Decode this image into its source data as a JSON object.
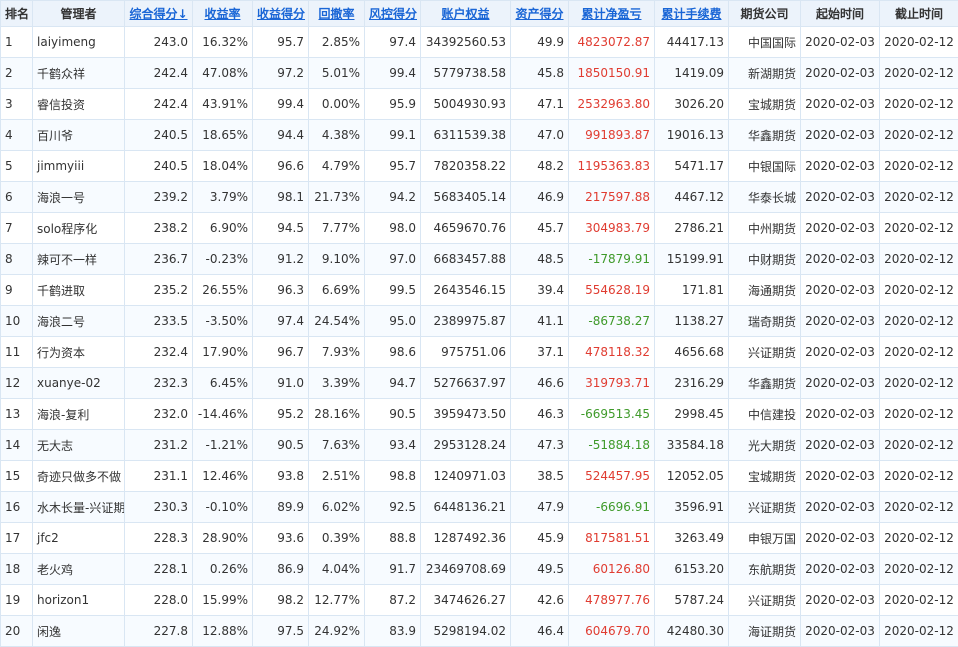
{
  "colors": {
    "header_bg": "#ecf3fb",
    "link": "#1a66d6",
    "positive": "#e03c31",
    "negative": "#3f9a2a",
    "border": "#d9e6f3"
  },
  "headers": [
    {
      "label": "排名",
      "sortable": false
    },
    {
      "label": "管理者",
      "sortable": false
    },
    {
      "label": "综合得分↓",
      "sortable": true
    },
    {
      "label": "收益率",
      "sortable": true
    },
    {
      "label": "收益得分",
      "sortable": true
    },
    {
      "label": "回撤率",
      "sortable": true
    },
    {
      "label": "风控得分",
      "sortable": true
    },
    {
      "label": "账户权益",
      "sortable": true
    },
    {
      "label": "资产得分",
      "sortable": true
    },
    {
      "label": "累计净盈亏",
      "sortable": true
    },
    {
      "label": "累计手续费",
      "sortable": true
    },
    {
      "label": "期货公司",
      "sortable": false
    },
    {
      "label": "起始时间",
      "sortable": false
    },
    {
      "label": "截止时间",
      "sortable": false
    }
  ],
  "rows": [
    {
      "rank": "1",
      "manager": "laiyimeng",
      "score": "243.0",
      "ret": "16.32%",
      "ret_score": "95.7",
      "dd": "2.85%",
      "risk_score": "97.4",
      "equity": "34392560.53",
      "asset_score": "49.9",
      "pnl": "4823072.87",
      "pnl_sign": "pos",
      "fee": "44417.13",
      "broker": "中国国际",
      "start": "2020-02-03",
      "end": "2020-02-12"
    },
    {
      "rank": "2",
      "manager": "千鹤众祥",
      "score": "242.4",
      "ret": "47.08%",
      "ret_score": "97.2",
      "dd": "5.01%",
      "risk_score": "99.4",
      "equity": "5779738.58",
      "asset_score": "45.8",
      "pnl": "1850150.91",
      "pnl_sign": "pos",
      "fee": "1419.09",
      "broker": "新湖期货",
      "start": "2020-02-03",
      "end": "2020-02-12"
    },
    {
      "rank": "3",
      "manager": "睿信投资",
      "score": "242.4",
      "ret": "43.91%",
      "ret_score": "99.4",
      "dd": "0.00%",
      "risk_score": "95.9",
      "equity": "5004930.93",
      "asset_score": "47.1",
      "pnl": "2532963.80",
      "pnl_sign": "pos",
      "fee": "3026.20",
      "broker": "宝城期货",
      "start": "2020-02-03",
      "end": "2020-02-12"
    },
    {
      "rank": "4",
      "manager": "百川爷",
      "score": "240.5",
      "ret": "18.65%",
      "ret_score": "94.4",
      "dd": "4.38%",
      "risk_score": "99.1",
      "equity": "6311539.38",
      "asset_score": "47.0",
      "pnl": "991893.87",
      "pnl_sign": "pos",
      "fee": "19016.13",
      "broker": "华鑫期货",
      "start": "2020-02-03",
      "end": "2020-02-12"
    },
    {
      "rank": "5",
      "manager": "jimmyiii",
      "score": "240.5",
      "ret": "18.04%",
      "ret_score": "96.6",
      "dd": "4.79%",
      "risk_score": "95.7",
      "equity": "7820358.22",
      "asset_score": "48.2",
      "pnl": "1195363.83",
      "pnl_sign": "pos",
      "fee": "5471.17",
      "broker": "中银国际",
      "start": "2020-02-03",
      "end": "2020-02-12"
    },
    {
      "rank": "6",
      "manager": "海浪一号",
      "score": "239.2",
      "ret": "3.79%",
      "ret_score": "98.1",
      "dd": "21.73%",
      "risk_score": "94.2",
      "equity": "5683405.14",
      "asset_score": "46.9",
      "pnl": "217597.88",
      "pnl_sign": "pos",
      "fee": "4467.12",
      "broker": "华泰长城",
      "start": "2020-02-03",
      "end": "2020-02-12"
    },
    {
      "rank": "7",
      "manager": "solo程序化",
      "score": "238.2",
      "ret": "6.90%",
      "ret_score": "94.5",
      "dd": "7.77%",
      "risk_score": "98.0",
      "equity": "4659670.76",
      "asset_score": "45.7",
      "pnl": "304983.79",
      "pnl_sign": "pos",
      "fee": "2786.21",
      "broker": "中州期货",
      "start": "2020-02-03",
      "end": "2020-02-12"
    },
    {
      "rank": "8",
      "manager": "辣可不一样",
      "score": "236.7",
      "ret": "-0.23%",
      "ret_score": "91.2",
      "dd": "9.10%",
      "risk_score": "97.0",
      "equity": "6683457.88",
      "asset_score": "48.5",
      "pnl": "-17879.91",
      "pnl_sign": "neg",
      "fee": "15199.91",
      "broker": "中财期货",
      "start": "2020-02-03",
      "end": "2020-02-12"
    },
    {
      "rank": "9",
      "manager": "千鹤进取",
      "score": "235.2",
      "ret": "26.55%",
      "ret_score": "96.3",
      "dd": "6.69%",
      "risk_score": "99.5",
      "equity": "2643546.15",
      "asset_score": "39.4",
      "pnl": "554628.19",
      "pnl_sign": "pos",
      "fee": "171.81",
      "broker": "海通期货",
      "start": "2020-02-03",
      "end": "2020-02-12"
    },
    {
      "rank": "10",
      "manager": "海浪二号",
      "score": "233.5",
      "ret": "-3.50%",
      "ret_score": "97.4",
      "dd": "24.54%",
      "risk_score": "95.0",
      "equity": "2389975.87",
      "asset_score": "41.1",
      "pnl": "-86738.27",
      "pnl_sign": "neg",
      "fee": "1138.27",
      "broker": "瑞奇期货",
      "start": "2020-02-03",
      "end": "2020-02-12"
    },
    {
      "rank": "11",
      "manager": "行为资本",
      "score": "232.4",
      "ret": "17.90%",
      "ret_score": "96.7",
      "dd": "7.93%",
      "risk_score": "98.6",
      "equity": "975751.06",
      "asset_score": "37.1",
      "pnl": "478118.32",
      "pnl_sign": "pos",
      "fee": "4656.68",
      "broker": "兴证期货",
      "start": "2020-02-03",
      "end": "2020-02-12"
    },
    {
      "rank": "12",
      "manager": "xuanye-02",
      "score": "232.3",
      "ret": "6.45%",
      "ret_score": "91.0",
      "dd": "3.39%",
      "risk_score": "94.7",
      "equity": "5276637.97",
      "asset_score": "46.6",
      "pnl": "319793.71",
      "pnl_sign": "pos",
      "fee": "2316.29",
      "broker": "华鑫期货",
      "start": "2020-02-03",
      "end": "2020-02-12"
    },
    {
      "rank": "13",
      "manager": "海浪-复利",
      "score": "232.0",
      "ret": "-14.46%",
      "ret_score": "95.2",
      "dd": "28.16%",
      "risk_score": "90.5",
      "equity": "3959473.50",
      "asset_score": "46.3",
      "pnl": "-669513.45",
      "pnl_sign": "neg",
      "fee": "2998.45",
      "broker": "中信建投",
      "start": "2020-02-03",
      "end": "2020-02-12"
    },
    {
      "rank": "14",
      "manager": "无大志",
      "score": "231.2",
      "ret": "-1.21%",
      "ret_score": "90.5",
      "dd": "7.63%",
      "risk_score": "93.4",
      "equity": "2953128.24",
      "asset_score": "47.3",
      "pnl": "-51884.18",
      "pnl_sign": "neg",
      "fee": "33584.18",
      "broker": "光大期货",
      "start": "2020-02-03",
      "end": "2020-02-12"
    },
    {
      "rank": "15",
      "manager": "奇迹只做多不做",
      "score": "231.1",
      "ret": "12.46%",
      "ret_score": "93.8",
      "dd": "2.51%",
      "risk_score": "98.8",
      "equity": "1240971.03",
      "asset_score": "38.5",
      "pnl": "524457.95",
      "pnl_sign": "pos",
      "fee": "12052.05",
      "broker": "宝城期货",
      "start": "2020-02-03",
      "end": "2020-02-12"
    },
    {
      "rank": "16",
      "manager": "水木长量-兴证期",
      "score": "230.3",
      "ret": "-0.10%",
      "ret_score": "89.9",
      "dd": "6.02%",
      "risk_score": "92.5",
      "equity": "6448136.21",
      "asset_score": "47.9",
      "pnl": "-6696.91",
      "pnl_sign": "neg",
      "fee": "3596.91",
      "broker": "兴证期货",
      "start": "2020-02-03",
      "end": "2020-02-12"
    },
    {
      "rank": "17",
      "manager": "jfc2",
      "score": "228.3",
      "ret": "28.90%",
      "ret_score": "93.6",
      "dd": "0.39%",
      "risk_score": "88.8",
      "equity": "1287492.36",
      "asset_score": "45.9",
      "pnl": "817581.51",
      "pnl_sign": "pos",
      "fee": "3263.49",
      "broker": "申银万国",
      "start": "2020-02-03",
      "end": "2020-02-12"
    },
    {
      "rank": "18",
      "manager": "老火鸡",
      "score": "228.1",
      "ret": "0.26%",
      "ret_score": "86.9",
      "dd": "4.04%",
      "risk_score": "91.7",
      "equity": "23469708.69",
      "asset_score": "49.5",
      "pnl": "60126.80",
      "pnl_sign": "pos",
      "fee": "6153.20",
      "broker": "东航期货",
      "start": "2020-02-03",
      "end": "2020-02-12"
    },
    {
      "rank": "19",
      "manager": "horizon1",
      "score": "228.0",
      "ret": "15.99%",
      "ret_score": "98.2",
      "dd": "12.77%",
      "risk_score": "87.2",
      "equity": "3474626.27",
      "asset_score": "42.6",
      "pnl": "478977.76",
      "pnl_sign": "pos",
      "fee": "5787.24",
      "broker": "兴证期货",
      "start": "2020-02-03",
      "end": "2020-02-12"
    },
    {
      "rank": "20",
      "manager": "闲逸",
      "score": "227.8",
      "ret": "12.88%",
      "ret_score": "97.5",
      "dd": "24.92%",
      "risk_score": "83.9",
      "equity": "5298194.02",
      "asset_score": "46.4",
      "pnl": "604679.70",
      "pnl_sign": "pos",
      "fee": "42480.30",
      "broker": "海证期货",
      "start": "2020-02-03",
      "end": "2020-02-12"
    }
  ]
}
